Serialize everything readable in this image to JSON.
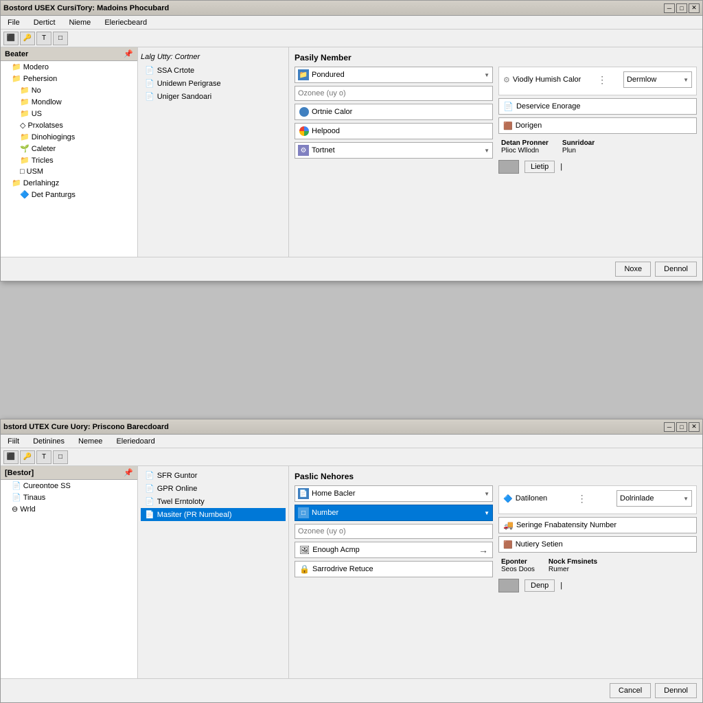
{
  "window1": {
    "title": "Bostord USEX CursiTory: Madoins Phocubard",
    "menu": [
      "File",
      "Dertict",
      "Nieme",
      "Eleriecbeard"
    ],
    "sidebar": {
      "header": "Beater",
      "items": [
        {
          "label": "Modero",
          "indent": 1,
          "type": "folder"
        },
        {
          "label": "Pehersion",
          "indent": 1,
          "type": "folder"
        },
        {
          "label": "No",
          "indent": 2,
          "type": "folder"
        },
        {
          "label": "Mondlow",
          "indent": 2,
          "type": "folder"
        },
        {
          "label": "US",
          "indent": 2,
          "type": "folder"
        },
        {
          "label": "Prxolatses",
          "indent": 2,
          "type": "item"
        },
        {
          "label": "Dinohiogings",
          "indent": 2,
          "type": "folder"
        },
        {
          "label": "Caleter",
          "indent": 2,
          "type": "item"
        },
        {
          "label": "Tricles",
          "indent": 2,
          "type": "folder"
        },
        {
          "label": "USM",
          "indent": 2,
          "type": "item"
        },
        {
          "label": "Derlahingz",
          "indent": 1,
          "type": "folder"
        },
        {
          "label": "Det Panturgs",
          "indent": 2,
          "type": "item"
        }
      ]
    },
    "list_items": [
      {
        "label": "SSA Crtote",
        "icon": "doc"
      },
      {
        "label": "Unidewn Perigrase",
        "icon": "doc"
      },
      {
        "label": "Uniger Sandoari",
        "icon": "doc"
      }
    ],
    "section_title": "Pasily Nember",
    "dropdown1": {
      "text": "Pondured",
      "icon": "folder"
    },
    "dropdown2": {
      "text": "Tortnet"
    },
    "input_label": "Ozonee (uy o)",
    "btn1": "Ortnie Calor",
    "btn2": "Helpood",
    "right_header": "Viodly Humish Calor",
    "right_btn1": "Deservice Enorage",
    "right_btn2": "Dorigen",
    "info_labels": [
      "Detan Pronner",
      "Sunridoar"
    ],
    "info_labels2": [
      "Plioc Wllodn",
      "Plun"
    ],
    "lookup_btn": "Lietip",
    "dropdown3": "Dermlow",
    "footer_btns": [
      "Noxe",
      "Dennol"
    ],
    "header_list": "Lalg Utty: Cortner"
  },
  "window2": {
    "title": "bstord UTEX Cure Uory: Priscono Barecdoard",
    "menu": [
      "Fiilt",
      "Detinines",
      "Nemee",
      "Eleriedoard"
    ],
    "sidebar": {
      "header": "[Bestor]",
      "items": [
        {
          "label": "Cureontoe SS",
          "indent": 1,
          "type": "item"
        },
        {
          "label": "Tinaus",
          "indent": 1,
          "type": "item"
        },
        {
          "label": "Wrld",
          "indent": 1,
          "type": "item"
        }
      ]
    },
    "list_items": [
      {
        "label": "SFR Guntor",
        "icon": "doc"
      },
      {
        "label": "GPR Online",
        "icon": "doc"
      },
      {
        "label": "Twel Erntoloty",
        "icon": "doc"
      },
      {
        "label": "Masiter (PR Numbeal)",
        "icon": "doc",
        "selected": true
      }
    ],
    "section_title": "Paslic Nehores",
    "dropdown1": {
      "text": "Home Bacler",
      "icon": "doc"
    },
    "subdropdown": {
      "text": "Number"
    },
    "input_label": "Ozonee (uy o)",
    "btn1": "Enough Acmp",
    "btn2": "Sarrodrive Retuce",
    "right_header": "Datilonen",
    "right_items": [
      {
        "label": "Seringe Fnabatensity Number"
      },
      {
        "label": "Nutiery Setien"
      }
    ],
    "info_labels": [
      "Eponter",
      "Nock Fmsinets"
    ],
    "info_labels2": [
      "Seos Doos",
      "Rumer"
    ],
    "lookup_btn": "Denp",
    "dropdown3": "Dolrinlade",
    "footer_btns": [
      "Cancel",
      "Dennol"
    ],
    "header_list": ""
  },
  "icons": {
    "folder": "📁",
    "doc": "📄",
    "gear": "⚙",
    "arrow_down": "▼",
    "arrow_right": "▶",
    "minimize": "─",
    "maximize": "□",
    "close": "✕",
    "pin": "📌"
  }
}
